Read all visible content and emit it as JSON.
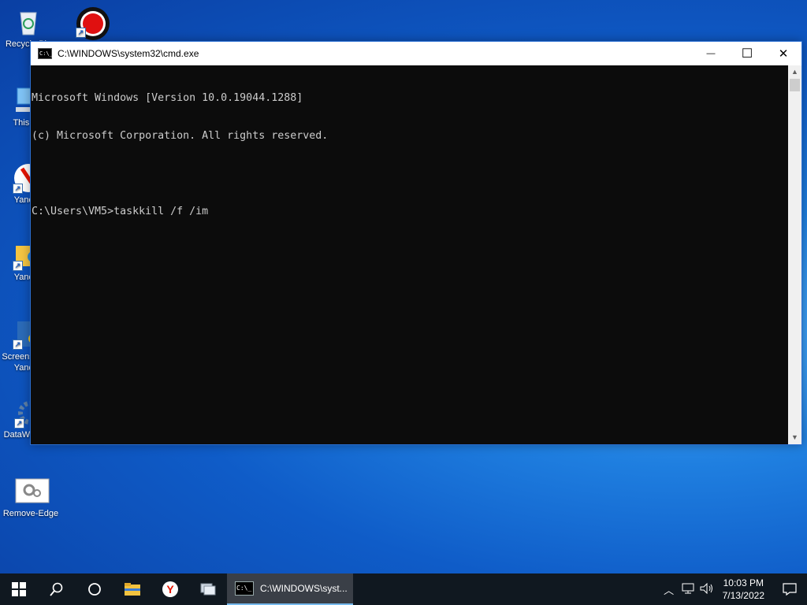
{
  "desktop": {
    "icons": [
      {
        "label": "Recycle Bin",
        "icon": "recycle-bin-icon"
      },
      {
        "label": "",
        "icon": "record-app-icon"
      },
      {
        "label": "This PC",
        "icon": "this-pc-icon"
      },
      {
        "label": "Yandex",
        "icon": "yandex-icon"
      },
      {
        "label": "Yandex",
        "icon": "yandex-folder-icon"
      },
      {
        "label": "Screenshot in Yandex",
        "icon": "screenshot-yandex-icon"
      },
      {
        "label": "DataWagon...",
        "icon": "datawagon-icon"
      },
      {
        "label": "Remove-Edge",
        "icon": "remove-edge-icon"
      }
    ]
  },
  "window": {
    "title": "C:\\WINDOWS\\system32\\cmd.exe",
    "minimize": "—",
    "maximize": "☐",
    "close": "✕",
    "console_lines": [
      "Microsoft Windows [Version 10.0.19044.1288]",
      "(c) Microsoft Corporation. All rights reserved.",
      "",
      "C:\\Users\\VM5>taskkill /f /im"
    ]
  },
  "taskbar": {
    "start": "start-icon",
    "active_task": "C:\\WINDOWS\\syst...",
    "time": "10:03 PM",
    "date": "7/13/2022"
  }
}
